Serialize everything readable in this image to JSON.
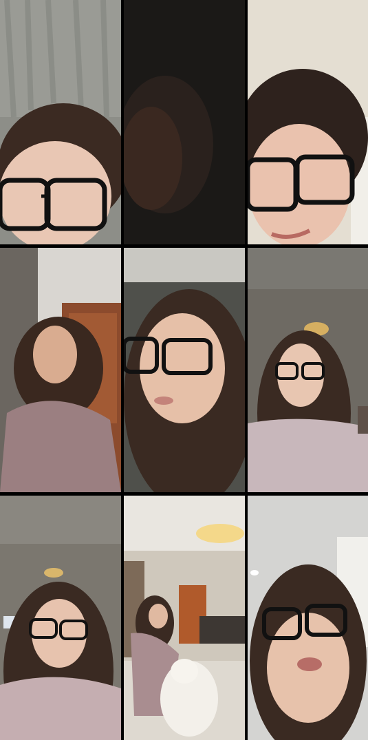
{
  "tiles": [
    {
      "id": "tile-1",
      "bg": "#8f9088",
      "accent": "#3b2a22"
    },
    {
      "id": "tile-2",
      "bg": "#1d1a18",
      "accent": "#2b2522"
    },
    {
      "id": "tile-3",
      "bg": "#e3ded3",
      "accent": "#2e221d"
    },
    {
      "id": "tile-4",
      "bg": "#d7d4cf",
      "accent": "#8c4b2d"
    },
    {
      "id": "tile-5",
      "bg": "#555651",
      "accent": "#3a2a22"
    },
    {
      "id": "tile-6",
      "bg": "#6f6b64",
      "accent": "#3a2a22"
    },
    {
      "id": "tile-7",
      "bg": "#7c7870",
      "accent": "#3a2a22"
    },
    {
      "id": "tile-8",
      "bg": "#cfc8bc",
      "accent": "#b05a2b"
    },
    {
      "id": "tile-9",
      "bg": "#d5d5d3",
      "accent": "#3a2a22"
    }
  ]
}
